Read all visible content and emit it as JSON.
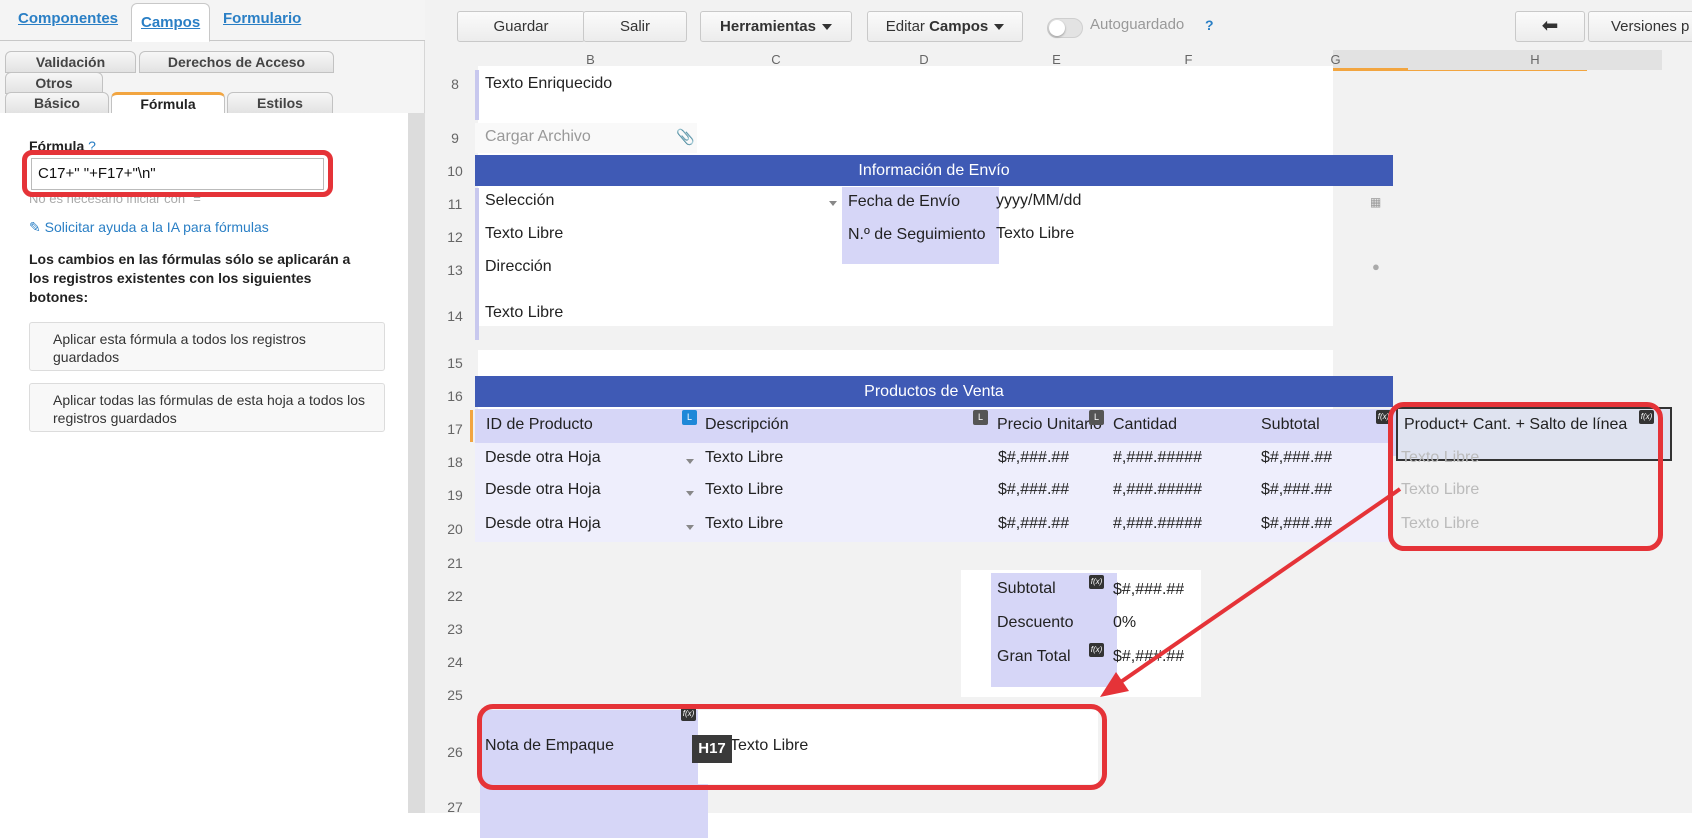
{
  "left_panel": {
    "top_tabs": [
      "Componentes",
      "Campos",
      "Formulario"
    ],
    "sub_tabs_row1": [
      "Validación",
      "Derechos de Acceso"
    ],
    "sub_tabs_row2": [
      "Otros"
    ],
    "sub_tabs_row3": [
      "Básico",
      "Fórmula",
      "Estilos"
    ],
    "formula_label": "Fórmula",
    "help_mark": "?",
    "formula_value": "C17+\" \"+F17+\"\\n\"",
    "hint": "No es necesario iniciar con \"=\"",
    "ai_link": "Solicitar ayuda a la IA para fórmulas",
    "warning": "Los cambios en las fórmulas sólo se aplicarán a los registros existentes con los siguientes botones:",
    "btn_apply_formula": "Aplicar esta fórmula a todos los registros guardados",
    "btn_apply_all": "Aplicar todas las fórmulas de esta hoja a todos los registros guardados"
  },
  "toolbar": {
    "save": "Guardar",
    "exit": "Salir",
    "tools": "Herramientas",
    "edit_prefix": "Editar",
    "edit_strong": "Campos",
    "autosave": "Autoguardado",
    "help": "?",
    "versions": "Versiones p"
  },
  "columns": [
    "B",
    "C",
    "D",
    "E",
    "F",
    "G",
    "H"
  ],
  "rows": [
    "8",
    "9",
    "10",
    "11",
    "12",
    "13",
    "14",
    "15",
    "16",
    "17",
    "18",
    "19",
    "20",
    "21",
    "22",
    "23",
    "24",
    "25",
    "26",
    "27"
  ],
  "cells": {
    "r8_b": "Texto Enriquecido",
    "r9_b": "Cargar Archivo",
    "r10_bar": "Información de Envío",
    "r11_b": "Selección",
    "r11_e": "Fecha de Envío",
    "r11_f": "yyyy/MM/dd",
    "r12_b": "Texto Libre",
    "r12_e": "N.º de Seguimiento",
    "r12_f": "Texto Libre",
    "r13_b": "Dirección",
    "r14_b": "Texto Libre",
    "r16_bar": "Productos de Venta",
    "r17": [
      "ID de Producto",
      "Descripción",
      "Precio Unitario",
      "Cantidad",
      "Subtotal",
      "Product+ Cant. + Salto de línea"
    ],
    "data_rows": [
      [
        "Desde otra Hoja",
        "Texto Libre",
        "$#,###.##",
        "#,###.#####",
        "$#,###.##",
        "Texto Libre"
      ],
      [
        "Desde otra Hoja",
        "Texto Libre",
        "$#,###.##",
        "#,###.#####",
        "$#,###.##",
        "Texto Libre"
      ],
      [
        "Desde otra Hoja",
        "Texto Libre",
        "$#,###.##",
        "#,###.#####",
        "$#,###.##",
        "Texto Libre"
      ]
    ],
    "totals": [
      {
        "label": "Subtotal",
        "value": "$#,###.##"
      },
      {
        "label": "Descuento",
        "value": "0%"
      },
      {
        "label": "Gran Total",
        "value": "$#,###.##"
      }
    ],
    "r26_label": "Nota de Empaque",
    "r26_value": "Texto Libre",
    "r26_tooltip": "H17",
    "badge_fx": "f(x)",
    "badge_l": "L"
  },
  "colors": {
    "accent_blue": "#3f5ab5",
    "lavender": "#d6d6f7",
    "highlight_red": "#e53338",
    "link_blue": "#2a7fc5",
    "tab_orange": "#f2a540"
  }
}
